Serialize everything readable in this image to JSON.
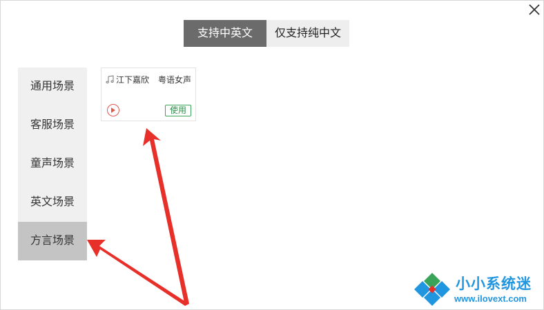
{
  "dialog": {
    "close_icon": "close-icon"
  },
  "tabs": [
    {
      "label": "支持中英文",
      "active": true
    },
    {
      "label": "仅支持纯中文",
      "active": false
    }
  ],
  "sidebar": {
    "items": [
      {
        "label": "通用场景"
      },
      {
        "label": "客服场景"
      },
      {
        "label": "童声场景"
      },
      {
        "label": "英文场景"
      },
      {
        "label": "方言场景",
        "selected": true
      }
    ]
  },
  "voice_card": {
    "icon": "music-note-icon",
    "name": "江下嘉欣",
    "type": "粤语女声",
    "play_icon": "play-icon",
    "use_label": "使用"
  },
  "watermark": {
    "title": "小小系统迷",
    "url": "www.ilovext.com"
  },
  "colors": {
    "active_tab": "#6b6b6b",
    "selected_side": "#c4c4c4",
    "use_button": "#3aa35a",
    "play_button": "#e05a4d",
    "arrow": "#e8302a",
    "watermark": "#2196e0"
  }
}
